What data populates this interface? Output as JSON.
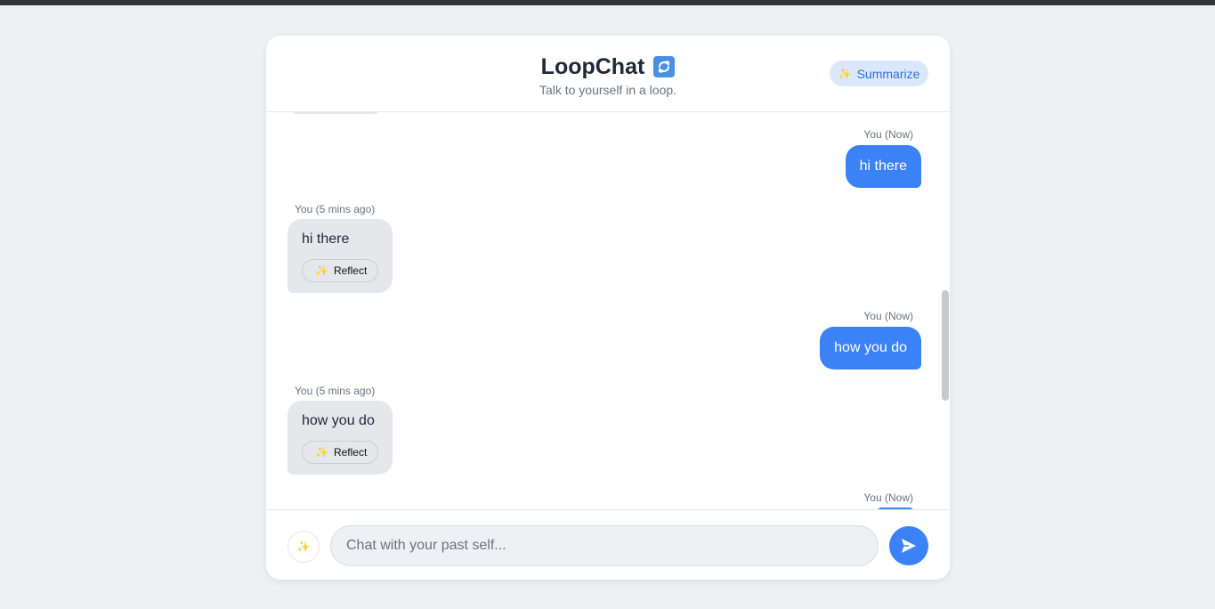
{
  "header": {
    "title": "LoopChat",
    "title_icon": "loop-arrows-icon",
    "subtitle": "Talk to yourself in a loop.",
    "summarize_label": "Summarize",
    "summarize_icon": "sparkle-icon"
  },
  "messages": [
    {
      "direction": "outgoing",
      "meta": "You (Now)",
      "text": "hi there"
    },
    {
      "direction": "incoming",
      "meta": "You (5 mins ago)",
      "text": "hi there",
      "action_label": "Reflect"
    },
    {
      "direction": "outgoing",
      "meta": "You (Now)",
      "text": "how you do"
    },
    {
      "direction": "incoming",
      "meta": "You (5 mins ago)",
      "text": "how you do",
      "action_label": "Reflect"
    },
    {
      "direction": "outgoing",
      "meta": "You (Now)",
      "text": ""
    }
  ],
  "composer": {
    "placeholder": "Chat with your past self...",
    "value": "",
    "magic_icon": "sparkle-icon",
    "send_icon": "send-icon"
  },
  "colors": {
    "accent": "#3b82f6",
    "incoming_bubble": "#e5e7eb",
    "page_background": "#eef1f4"
  }
}
